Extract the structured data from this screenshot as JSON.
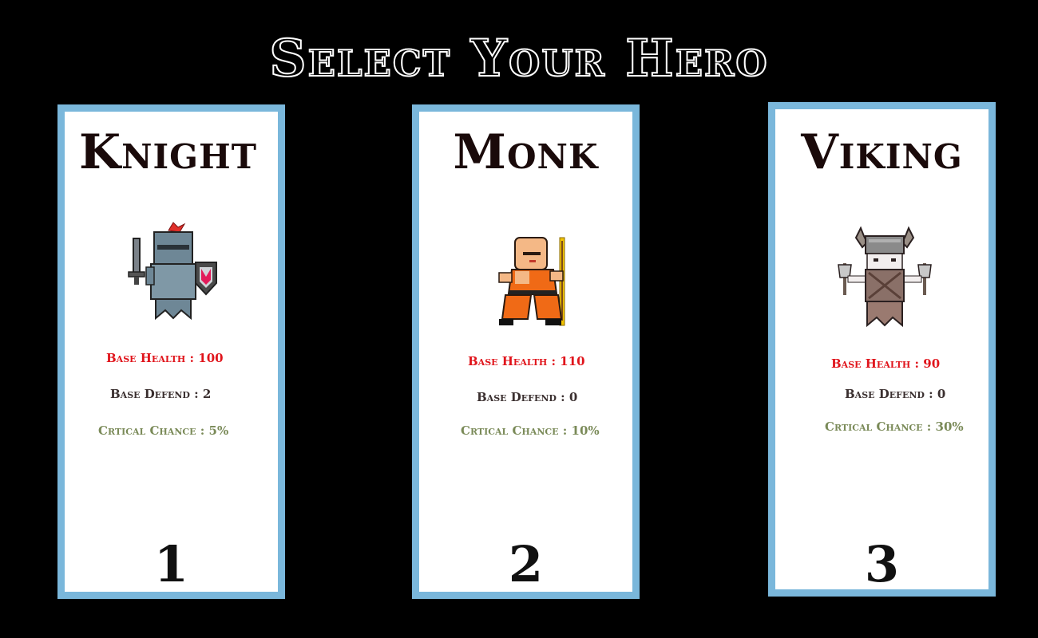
{
  "title": "Select Your Hero",
  "heroes": [
    {
      "name": "Knight",
      "health": "Base Health : 100",
      "defend": "Base Defend : 2",
      "crit": "Crtical Chance : 5%",
      "number": "1",
      "icon": "knight-sprite"
    },
    {
      "name": "Monk",
      "health": "Base Health : 110",
      "defend": "Base Defend : 0",
      "crit": "Crtical Chance : 10%",
      "number": "2",
      "icon": "monk-sprite"
    },
    {
      "name": "Viking",
      "health": "Base Health : 90",
      "defend": "Base Defend : 0",
      "crit": "Crtical Chance : 30%",
      "number": "3",
      "icon": "viking-sprite"
    }
  ],
  "colors": {
    "background": "#000000",
    "card_border": "#7ab7db",
    "health": "#e0141b",
    "defend": "#3a2f2f",
    "crit": "#7a8a58"
  }
}
